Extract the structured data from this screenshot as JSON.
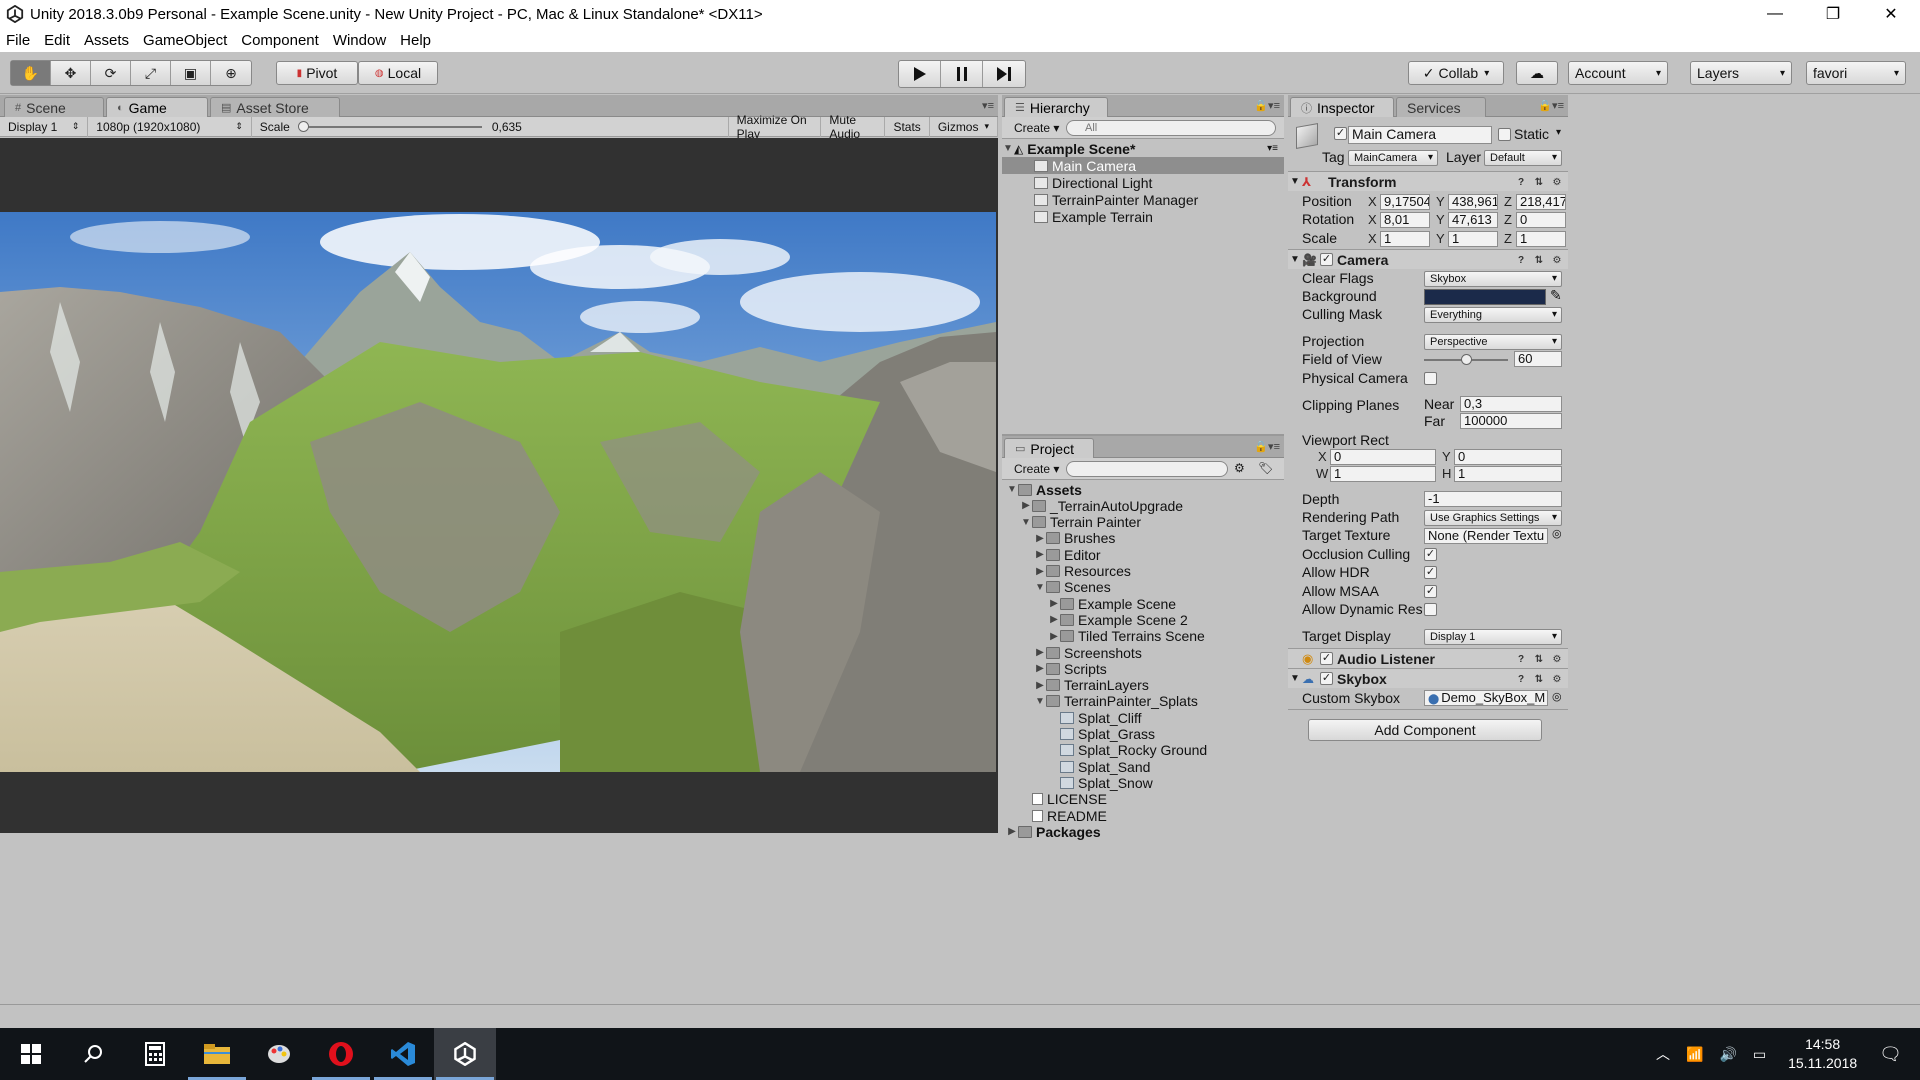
{
  "window": {
    "title": "Unity 2018.3.0b9 Personal - Example Scene.unity - New Unity Project - PC, Mac & Linux Standalone* <DX11>",
    "controls": [
      "—",
      "❐",
      "✕"
    ]
  },
  "menu": [
    "File",
    "Edit",
    "Assets",
    "GameObject",
    "Component",
    "Window",
    "Help"
  ],
  "toolbar": {
    "tools": [
      "hand-icon",
      "move-icon",
      "rotate-icon",
      "scale-icon",
      "rect-icon",
      "transform-icon"
    ],
    "pivot": "Pivot",
    "local": "Local",
    "collab": "Collab",
    "account": "Account",
    "layers": "Layers",
    "layout": "favori"
  },
  "scene_tabs": [
    "Scene",
    "Game",
    "Asset Store"
  ],
  "game_bar": {
    "display": "Display 1",
    "resolution": "1080p (1920x1080)",
    "scale_label": "Scale",
    "scale_value": "0,635",
    "maximize": "Maximize On Play",
    "mute": "Mute Audio",
    "stats": "Stats",
    "gizmos": "Gizmos"
  },
  "hierarchy": {
    "tab": "Hierarchy",
    "create": "Create",
    "search_placeholder": "All",
    "scene": "Example Scene*",
    "items": [
      "Main Camera",
      "Directional Light",
      "TerrainPainter Manager",
      "Example Terrain"
    ]
  },
  "project": {
    "tab": "Project",
    "create": "Create",
    "tree": [
      {
        "label": "Assets",
        "depth": 0,
        "type": "folder",
        "expanded": true,
        "bold": true
      },
      {
        "label": "_TerrainAutoUpgrade",
        "depth": 1,
        "type": "folder",
        "expanded": false
      },
      {
        "label": "Terrain Painter",
        "depth": 1,
        "type": "folder",
        "expanded": true
      },
      {
        "label": "Brushes",
        "depth": 2,
        "type": "folder",
        "expanded": false
      },
      {
        "label": "Editor",
        "depth": 2,
        "type": "folder",
        "expanded": false
      },
      {
        "label": "Resources",
        "depth": 2,
        "type": "folder",
        "expanded": false
      },
      {
        "label": "Scenes",
        "depth": 2,
        "type": "folder",
        "expanded": true
      },
      {
        "label": "Example Scene",
        "depth": 3,
        "type": "folder",
        "expanded": false
      },
      {
        "label": "Example Scene 2",
        "depth": 3,
        "type": "folder",
        "expanded": false
      },
      {
        "label": "Tiled Terrains Scene",
        "depth": 3,
        "type": "folder",
        "expanded": false
      },
      {
        "label": "Screenshots",
        "depth": 2,
        "type": "folder",
        "expanded": false
      },
      {
        "label": "Scripts",
        "depth": 2,
        "type": "folder",
        "expanded": false
      },
      {
        "label": "TerrainLayers",
        "depth": 2,
        "type": "folder",
        "expanded": false
      },
      {
        "label": "TerrainPainter_Splats",
        "depth": 2,
        "type": "folder",
        "expanded": true
      },
      {
        "label": "Splat_Cliff",
        "depth": 3,
        "type": "splat"
      },
      {
        "label": "Splat_Grass",
        "depth": 3,
        "type": "splat"
      },
      {
        "label": "Splat_Rocky Ground",
        "depth": 3,
        "type": "splat"
      },
      {
        "label": "Splat_Sand",
        "depth": 3,
        "type": "splat"
      },
      {
        "label": "Splat_Snow",
        "depth": 3,
        "type": "splat"
      },
      {
        "label": "LICENSE",
        "depth": 1,
        "type": "doc"
      },
      {
        "label": "README",
        "depth": 1,
        "type": "doc"
      },
      {
        "label": "Packages",
        "depth": 0,
        "type": "folder",
        "expanded": false,
        "bold": true
      }
    ]
  },
  "inspector": {
    "tab": "Inspector",
    "tab2": "Services",
    "object_name": "Main Camera",
    "static": "Static",
    "tag_label": "Tag",
    "tag": "MainCamera",
    "layer_label": "Layer",
    "layer": "Default",
    "transform": {
      "title": "Transform",
      "position_label": "Position",
      "rotation_label": "Rotation",
      "scale_label": "Scale",
      "position": [
        "9,17504",
        "438,961",
        "218,417"
      ],
      "rotation": [
        "8,01",
        "47,613",
        "0"
      ],
      "scale": [
        "1",
        "1",
        "1"
      ]
    },
    "camera": {
      "title": "Camera",
      "clear_flags_label": "Clear Flags",
      "clear_flags": "Skybox",
      "background_label": "Background",
      "background_color": "#1b2a4a",
      "culling_label": "Culling Mask",
      "culling": "Everything",
      "projection_label": "Projection",
      "projection": "Perspective",
      "fov_label": "Field of View",
      "fov": "60",
      "fov_fraction": 0.5,
      "physical_label": "Physical Camera",
      "clipping_label": "Clipping Planes",
      "near_label": "Near",
      "near": "0,3",
      "far_label": "Far",
      "far": "100000",
      "viewport_label": "Viewport Rect",
      "vx": "0",
      "vy": "0",
      "vw": "1",
      "vh": "1",
      "depth_label": "Depth",
      "depth": "-1",
      "rendering_label": "Rendering Path",
      "rendering": "Use Graphics Settings",
      "target_tex_label": "Target Texture",
      "target_tex": "None (Render Textu",
      "occlusion_label": "Occlusion Culling",
      "hdr_label": "Allow HDR",
      "msaa_label": "Allow MSAA",
      "dynres_label": "Allow Dynamic Resol",
      "display_label": "Target Display",
      "display": "Display 1"
    },
    "audio": {
      "title": "Audio Listener"
    },
    "skybox": {
      "title": "Skybox",
      "custom_label": "Custom Skybox",
      "custom": "Demo_SkyBox_M"
    },
    "add_component": "Add Component"
  },
  "taskbar": {
    "time": "14:58",
    "date": "15.11.2018"
  }
}
